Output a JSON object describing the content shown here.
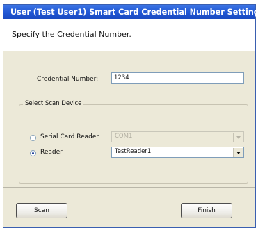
{
  "window": {
    "title": "User (Test User1) Smart Card Credential Number Setting"
  },
  "header": {
    "instruction": "Specify the Credential Number."
  },
  "form": {
    "credential_label": "Credential Number:",
    "credential_value": "1234",
    "scan_device_group": "Select Scan Device",
    "serial_reader_label": "Serial Card Reader",
    "serial_reader_value": "COM1",
    "serial_reader_selected": false,
    "reader_label": "Reader",
    "reader_value": "TestReader1",
    "reader_selected": true
  },
  "buttons": {
    "scan": "Scan",
    "finish": "Finish"
  },
  "colors": {
    "titlebar": "#1f55d3",
    "dialog_bg": "#ece9d8",
    "input_border": "#7f9db9"
  }
}
